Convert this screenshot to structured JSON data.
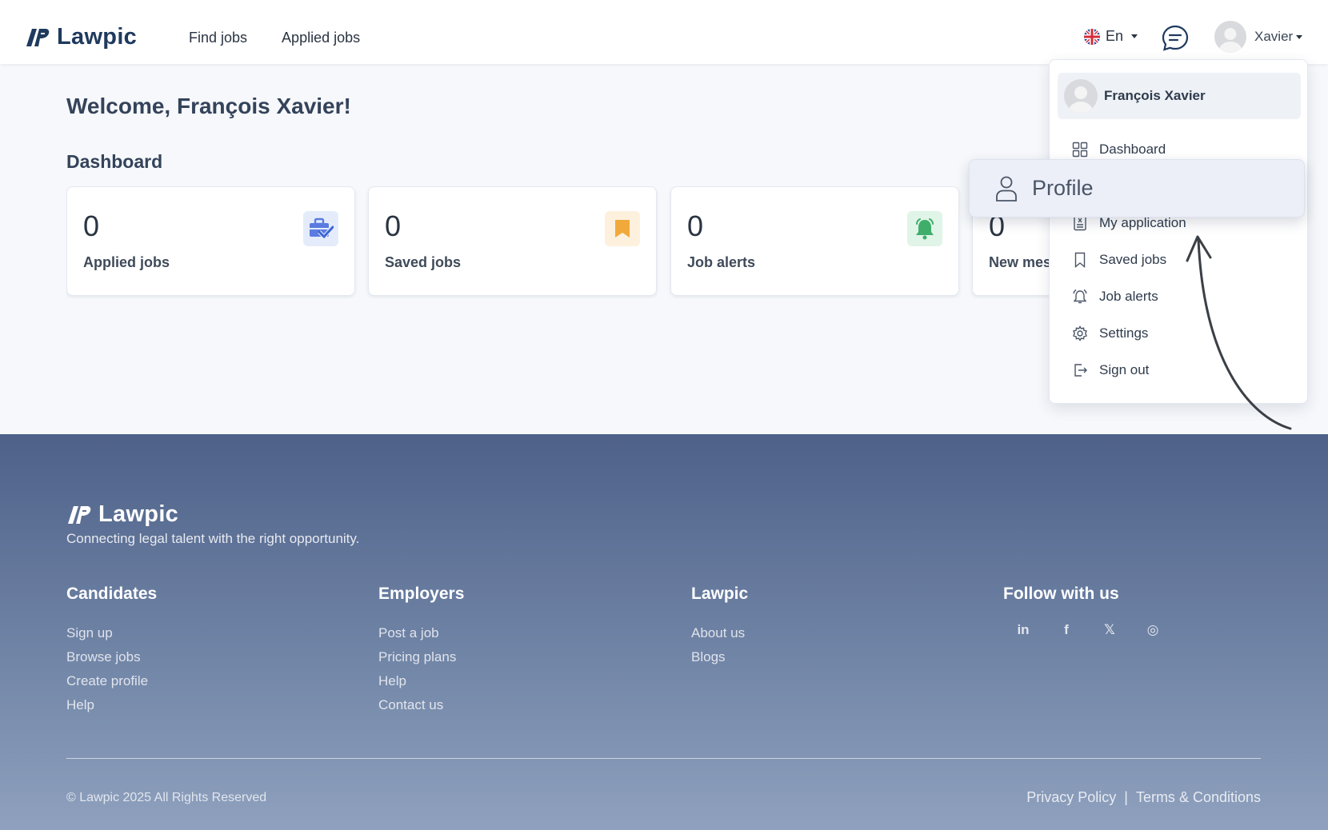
{
  "header": {
    "brand": "Lawpic",
    "nav": [
      "Find jobs",
      "Applied jobs"
    ],
    "language": "En",
    "user_short": "Xavier"
  },
  "main": {
    "welcome": "Welcome, François Xavier!",
    "dashboard_title": "Dashboard",
    "cards": [
      {
        "value": "0",
        "label": "Applied jobs",
        "icon": "briefcase-check-icon",
        "color": "#5a7be0",
        "bg": "#e4ecfb"
      },
      {
        "value": "0",
        "label": "Saved jobs",
        "icon": "bookmark-icon",
        "color": "#f2a93b",
        "bg": "#fdf1de"
      },
      {
        "value": "0",
        "label": "Job alerts",
        "icon": "bell-icon",
        "color": "#3fae6a",
        "bg": "#e0f4e7"
      },
      {
        "value": "0",
        "label": "New mes",
        "icon": "message-icon",
        "color": "#5a7be0",
        "bg": "#e4ecfb"
      }
    ]
  },
  "dropdown": {
    "user_name": "François Xavier",
    "items": [
      {
        "label": "Dashboard",
        "icon": "grid-icon"
      },
      {
        "label": "My application",
        "icon": "document-icon"
      },
      {
        "label": "Saved jobs",
        "icon": "bookmark-icon"
      },
      {
        "label": "Job alerts",
        "icon": "bell-icon"
      },
      {
        "label": "Settings",
        "icon": "gear-icon"
      },
      {
        "label": "Sign out",
        "icon": "sign-out-icon"
      }
    ],
    "highlight": {
      "label": "Profile",
      "icon": "user-icon"
    }
  },
  "footer": {
    "brand": "Lawpic",
    "tagline": "Connecting legal talent with the right opportunity.",
    "columns": [
      {
        "title": "Candidates",
        "links": [
          "Sign up",
          "Browse jobs",
          "Create profile",
          "Help"
        ]
      },
      {
        "title": "Employers",
        "links": [
          "Post a job",
          "Pricing plans",
          "Help",
          "Contact us"
        ]
      },
      {
        "title": "Lawpic",
        "links": [
          "About us",
          "Blogs"
        ]
      }
    ],
    "follow_title": "Follow with us",
    "socials": [
      "in",
      "f",
      "𝕏",
      "◎"
    ],
    "copyright": "© Lawpic 2025 All Rights Reserved",
    "privacy": "Privacy Policy",
    "separator": "|",
    "terms": "Terms & Conditions"
  }
}
